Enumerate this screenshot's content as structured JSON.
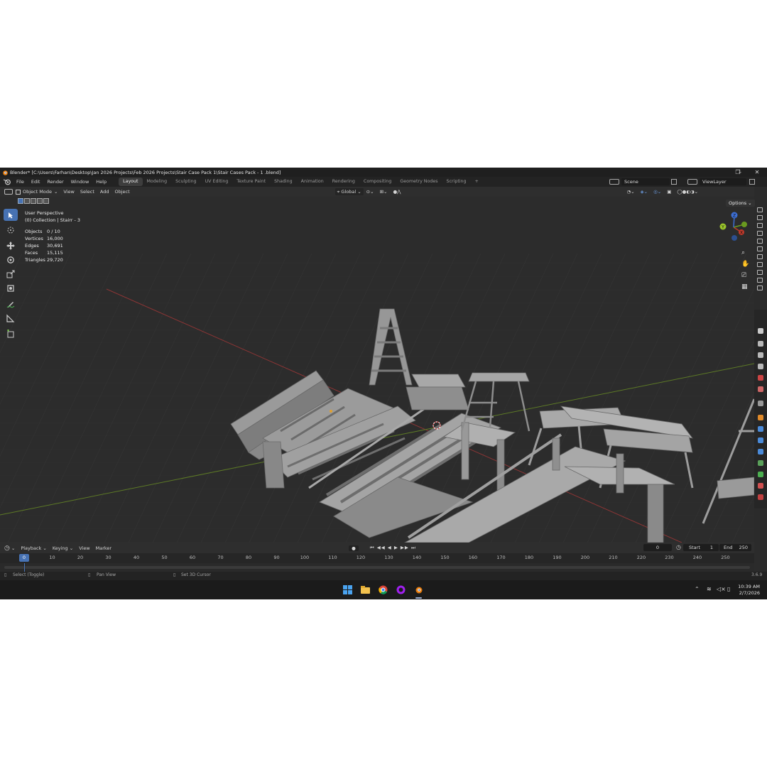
{
  "window": {
    "title": "Blender* [C:\\Users\\Farhan\\Desktop\\Jan 2026 Projects\\Feb 2026 Projects\\Stair Case Pack 1\\Stair Cases Pack - 1 .blend]",
    "minimize": "–",
    "maximize": "❐",
    "close": "✕"
  },
  "menus": [
    "File",
    "Edit",
    "Render",
    "Window",
    "Help"
  ],
  "workspaces": [
    "Layout",
    "Modeling",
    "Sculpting",
    "UV Editing",
    "Texture Paint",
    "Shading",
    "Animation",
    "Rendering",
    "Compositing",
    "Geometry Nodes",
    "Scripting"
  ],
  "workspace_add": "+",
  "active_workspace": "Layout",
  "scene": "Scene",
  "view_layer": "ViewLayer",
  "header": {
    "mode": "Object Mode",
    "view": "View",
    "select": "Select",
    "add": "Add",
    "object": "Object",
    "transform_orientation": "Global",
    "options": "Options"
  },
  "viewport": {
    "perspective": "User Perspective",
    "collection": "(0) Collection | Stairr - 3",
    "stats": [
      {
        "label": "Objects",
        "value": "0 / 10"
      },
      {
        "label": "Vertices",
        "value": "16,000"
      },
      {
        "label": "Edges",
        "value": "30,691"
      },
      {
        "label": "Faces",
        "value": "15,115"
      },
      {
        "label": "Triangles",
        "value": "29,720"
      }
    ],
    "gizmo": {
      "x": "X",
      "y": "Y",
      "z": "Z"
    }
  },
  "timeline": {
    "playback": "Playback",
    "keying": "Keying",
    "view": "View",
    "marker": "Marker",
    "current_frame": "0",
    "start_label": "Start",
    "start": "1",
    "end_label": "End",
    "end": "250",
    "ticks": [
      "0",
      "10",
      "20",
      "30",
      "40",
      "50",
      "60",
      "70",
      "80",
      "90",
      "100",
      "110",
      "120",
      "130",
      "140",
      "150",
      "160",
      "170",
      "180",
      "190",
      "200",
      "210",
      "220",
      "230",
      "240",
      "250"
    ]
  },
  "statusbar": {
    "select": "Select (Toggle)",
    "pan": "Pan View",
    "cursor": "Set 3D Cursor",
    "version": "3.6.9"
  },
  "taskbar": {
    "time": "10:39 AM",
    "date": "2/7/2026"
  },
  "colors": {
    "accent": "#4772b3",
    "x_axis": "#c0392b",
    "y_axis": "#6a9a1f",
    "z_axis": "#3d6fd6"
  }
}
